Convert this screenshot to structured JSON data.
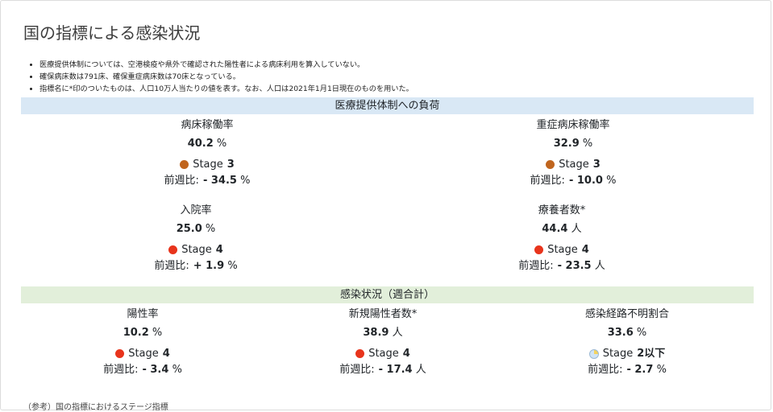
{
  "title": "国の指標による感染状況",
  "notes": [
    "医療提供体制については、空港検疫や県外で確認された陽性者による病床利用を算入していない。",
    "確保病床数は791床、確保重症病床数は70床となっている。",
    "指標名に*印のついたものは、人口10万人当たりの値を表す。なお、人口は2021年1月1日現在のものを用いた。"
  ],
  "colors": {
    "stage3": "#c0651e",
    "stage4": "#e8341c",
    "stage2": "#cfe3f5",
    "section1_bg": "#d9e8f5",
    "section2_bg": "#e2efda"
  },
  "medical": {
    "header": "医療提供体制への負荷",
    "bed_occupancy": {
      "label": "病床稼働率",
      "value": "40.2",
      "unit": "%",
      "stage_prefix": "Stage",
      "stage": "3",
      "change_label": "前週比:",
      "change": "- 34.5",
      "change_unit": "%"
    },
    "severe_bed_occupancy": {
      "label": "重症病床稼働率",
      "value": "32.9",
      "unit": "%",
      "stage_prefix": "Stage",
      "stage": "3",
      "change_label": "前週比:",
      "change": "- 10.0",
      "change_unit": "%"
    },
    "hospitalization_rate": {
      "label": "入院率",
      "value": "25.0",
      "unit": "%",
      "stage_prefix": "Stage",
      "stage": "4",
      "change_label": "前週比:",
      "change": "+ 1.9",
      "change_unit": "%"
    },
    "patients_under_care": {
      "label": "療養者数*",
      "value": "44.4",
      "unit": "人",
      "stage_prefix": "Stage",
      "stage": "4",
      "change_label": "前週比:",
      "change": "- 23.5",
      "change_unit": "人"
    }
  },
  "infection": {
    "header": "感染状況（週合計）",
    "positivity_rate": {
      "label": "陽性率",
      "value": "10.2",
      "unit": "%",
      "stage_prefix": "Stage",
      "stage": "4",
      "change_label": "前週比:",
      "change": "- 3.4",
      "change_unit": "%"
    },
    "new_cases": {
      "label": "新規陽性者数*",
      "value": "38.9",
      "unit": "人",
      "stage_prefix": "Stage",
      "stage": "4",
      "change_label": "前週比:",
      "change": "- 17.4",
      "change_unit": "人"
    },
    "unknown_route": {
      "label": "感染経路不明割合",
      "value": "33.6",
      "unit": "%",
      "stage_prefix": "Stage",
      "stage": "2以下",
      "change_label": "前週比:",
      "change": "- 2.7",
      "change_unit": "%"
    }
  },
  "footnote": "（参考）国の指標におけるステージ指標"
}
